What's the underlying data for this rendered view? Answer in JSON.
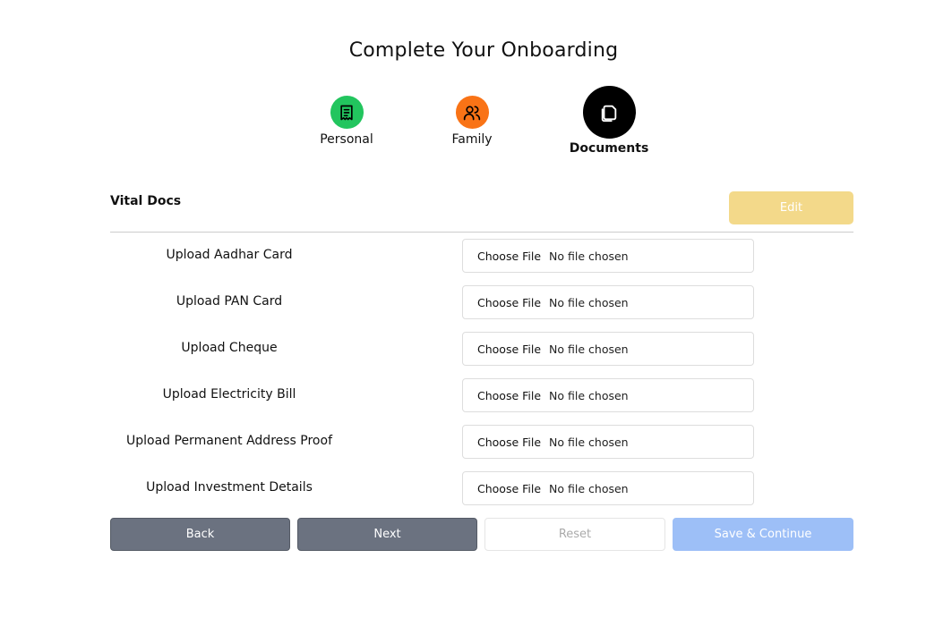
{
  "page": {
    "title": "Complete Your Onboarding"
  },
  "steps": [
    {
      "label": "Personal",
      "icon": "receipt-icon",
      "color": "#22c55e"
    },
    {
      "label": "Family",
      "icon": "users-icon",
      "color": "#f97316"
    },
    {
      "label": "Documents",
      "icon": "copy-icon",
      "color": "#000000",
      "active": true
    }
  ],
  "section": {
    "title": "Vital Docs",
    "edit_label": "Edit"
  },
  "uploads": [
    {
      "label": "Upload Aadhar Card",
      "button": "Choose File",
      "status": "No file chosen"
    },
    {
      "label": "Upload PAN Card",
      "button": "Choose File",
      "status": "No file chosen"
    },
    {
      "label": "Upload Cheque",
      "button": "Choose File",
      "status": "No file chosen"
    },
    {
      "label": "Upload Electricity Bill",
      "button": "Choose File",
      "status": "No file chosen"
    },
    {
      "label": "Upload Permanent Address Proof",
      "button": "Choose File",
      "status": "No file chosen"
    },
    {
      "label": "Upload Investment Details",
      "button": "Choose File",
      "status": "No file chosen"
    }
  ],
  "actions": {
    "back": "Back",
    "next": "Next",
    "reset": "Reset",
    "save": "Save & Continue"
  }
}
